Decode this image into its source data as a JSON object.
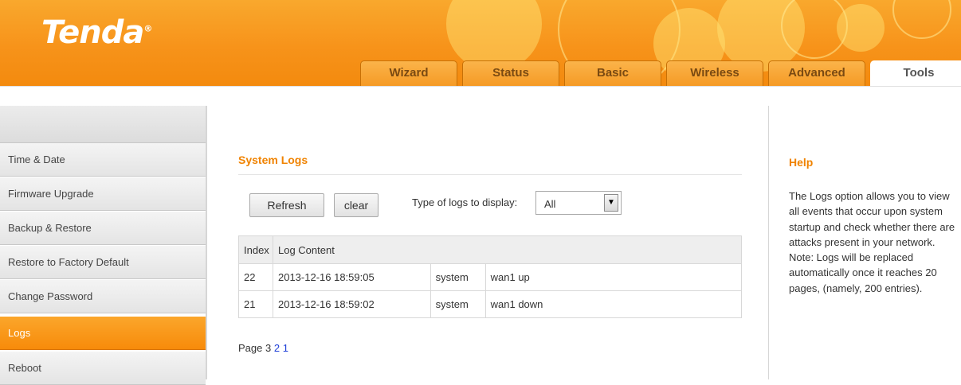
{
  "brand": {
    "logo": "Tenda",
    "logo_mark": "®"
  },
  "tabs": [
    {
      "label": "Wizard",
      "active": false
    },
    {
      "label": "Status",
      "active": false
    },
    {
      "label": "Basic",
      "active": false
    },
    {
      "label": "Wireless",
      "active": false
    },
    {
      "label": "Advanced",
      "active": false
    },
    {
      "label": "Tools",
      "active": true
    }
  ],
  "sidebar": {
    "items": [
      {
        "label": "Time & Date",
        "active": false
      },
      {
        "label": "Firmware Upgrade",
        "active": false
      },
      {
        "label": "Backup & Restore",
        "active": false
      },
      {
        "label": "Restore to Factory Default",
        "active": false
      },
      {
        "label": "Change Password",
        "active": false
      },
      {
        "label": "Logs",
        "active": true
      },
      {
        "label": "Reboot",
        "active": false
      }
    ]
  },
  "main": {
    "title": "System Logs",
    "refresh_label": "Refresh",
    "clear_label": "clear",
    "filter_label": "Type of logs to display:",
    "filter_value": "All",
    "table": {
      "headers": [
        "Index",
        "Log Content"
      ],
      "rows": [
        {
          "index": "22",
          "time": "2013-12-16 18:59:05",
          "type": "system",
          "message": "wan1 up"
        },
        {
          "index": "21",
          "time": "2013-12-16 18:59:02",
          "type": "system",
          "message": "wan1 down"
        }
      ]
    },
    "pager": {
      "prefix": "Page",
      "current": "3",
      "links": [
        "2",
        "1"
      ]
    }
  },
  "help": {
    "title": "Help",
    "text": "The Logs option allows you to view all events that occur upon system startup and check whether there are attacks present in your network. Note: Logs will be replaced automatically once it reaches 20 pages, (namely, 200 entries)."
  },
  "colors": {
    "brand_orange": "#f7931a",
    "accent_text": "#f08300",
    "link": "#1e3fd8"
  },
  "icons": {
    "select_arrow": "dropdown-arrow-icon"
  }
}
